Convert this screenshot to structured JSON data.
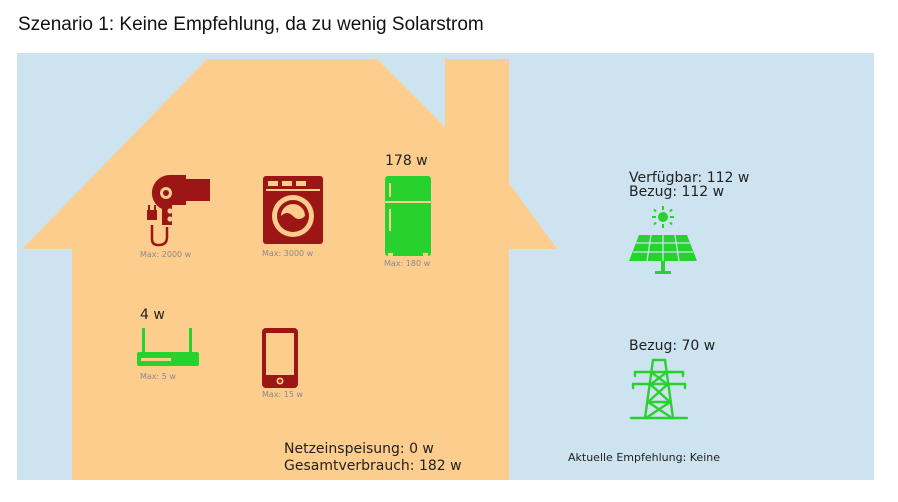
{
  "title": "Szenario 1: Keine Empfehlung, da zu wenig Solarstrom",
  "colors": {
    "sky": "#cde3f0",
    "house": "#fdcd8d",
    "active": "#27d22f",
    "inactive": "#9d1616"
  },
  "devices": [
    {
      "name": "hair-dryer",
      "icon": "hair-dryer-icon",
      "state": "inactive",
      "power_label": "",
      "max_label": "Max: 2000 w"
    },
    {
      "name": "washing-machine",
      "icon": "washing-machine-icon",
      "state": "inactive",
      "power_label": "",
      "max_label": "Max: 3000 w"
    },
    {
      "name": "fridge",
      "icon": "fridge-icon",
      "state": "active",
      "power_label": "178 w",
      "max_label": "Max: 180 w"
    },
    {
      "name": "router",
      "icon": "router-icon",
      "state": "active",
      "power_label": "4 w",
      "max_label": "Max: 5 w"
    },
    {
      "name": "smartphone",
      "icon": "smartphone-icon",
      "state": "inactive",
      "power_label": "",
      "max_label": "Max: 15 w"
    }
  ],
  "solar": {
    "available": "Verfügbar: 112 w",
    "usage": "Bezug: 112 w",
    "icon": "solar-panel-icon"
  },
  "grid": {
    "usage": "Bezug: 70 w",
    "icon": "power-tower-icon"
  },
  "totals": {
    "feed_in": "Netzeinspeisung: 0 w",
    "consumption": "Gesamtverbrauch: 182 w"
  },
  "recommendation": "Aktuelle Empfehlung: Keine"
}
